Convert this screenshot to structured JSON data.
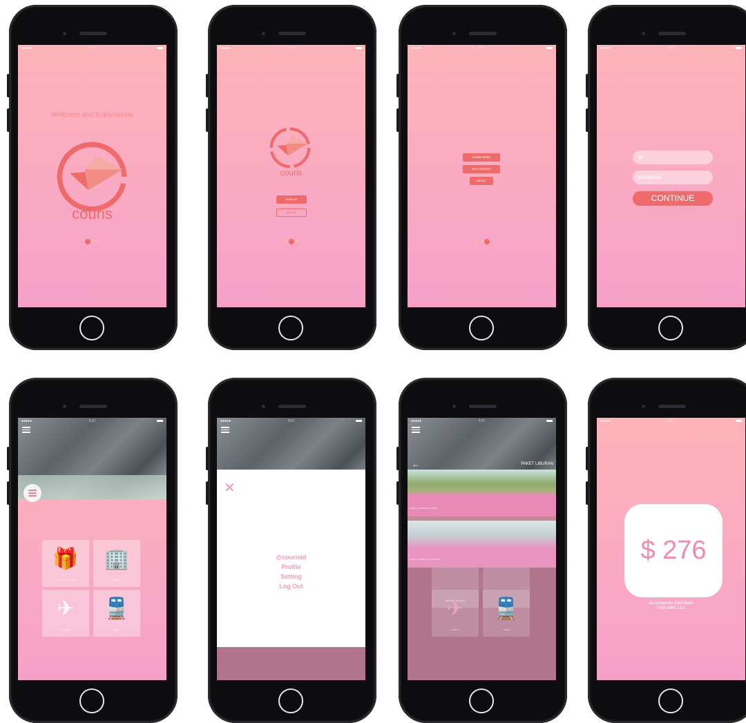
{
  "status": {
    "carrier_dots": "●●●●●",
    "time": "9:41"
  },
  "onboarding": {
    "welcome_text": "Welcome and Enjoy couris",
    "brand": "couris"
  },
  "auth": {
    "signup_label": "SIGN UP",
    "signin_label": "SIGN IN"
  },
  "info_menu": {
    "items": [
      "LEARN MORE",
      "WHY COURIS?",
      "ABOUT"
    ]
  },
  "login": {
    "id_placeholder": "id",
    "password_placeholder": "password",
    "continue_label": "CONTINUE"
  },
  "home": {
    "tiles": [
      {
        "icon": "gift-icon",
        "label": "HOLIDAY PACKAGE"
      },
      {
        "icon": "hotel-icon",
        "label": "HOTEL"
      },
      {
        "icon": "plane-icon",
        "label": "FLIGHT"
      },
      {
        "icon": "train-icon",
        "label": "TRAIN"
      }
    ]
  },
  "side_menu": {
    "items": [
      "@courisid",
      "Profile",
      "Setting",
      "Log Out"
    ]
  },
  "paket": {
    "title": "PAKET LIBURAN",
    "cards": [
      "PAKET 1 LOMBOK JOURNEY",
      "PAKET 2 LOMBOK ADVENTURE"
    ]
  },
  "payment": {
    "amount": "$ 276",
    "bank": "via Indonesia Gold Bank",
    "account": "7666-0981-1111"
  },
  "colors": {
    "accent": "#ef6b6b",
    "pink": "#f29ab2",
    "mauve": "#b0758d"
  }
}
